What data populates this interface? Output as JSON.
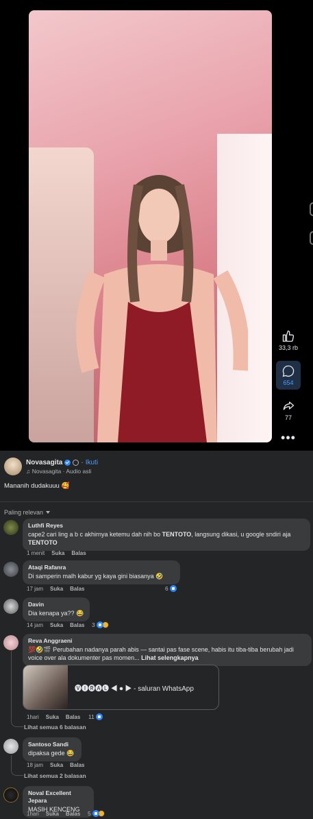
{
  "video": {
    "likes": "33,3 rb",
    "comments_count": "654",
    "shares": "77"
  },
  "post": {
    "author": "Novasagita",
    "follow_label": "Ikuti",
    "audio": "Novasagita · Audio asli",
    "caption": "Mananih dudakuuu 🥰"
  },
  "sort_label": "Paling relevan",
  "comments": [
    {
      "name": "Luthfi Reyes",
      "text_html": "cape2 cari ling a b c akhirnya ketemu dah nih bo <b>TENTOTO</b>, langsung dikasi, u google sndiri aja <b>TENTOTO</b>",
      "time": "1 menit",
      "like": "Suka",
      "reply": "Balas"
    },
    {
      "name": "Ataqi Rafanra",
      "text": "Di samperin malh kabur yg kaya gini biasanya 🤣",
      "time": "17 jam",
      "like": "Suka",
      "reply": "Balas",
      "reactions": "6"
    },
    {
      "name": "Davin",
      "text": "Dia kenapa ya?? 😂",
      "time": "14 jam",
      "like": "Suka",
      "reply": "Balas",
      "reactions": "3"
    },
    {
      "name": "Reva Anggraeni",
      "text": "💯🤣🎬 Perubahan nadanya parah abis — santai pas fase scene, habis itu tiba-tiba berubah jadi voice over ala dokumenter pas momen...",
      "see_more": "Lihat selengkapnya",
      "link_text": "🅥🅘🅡🅐🅛 ◀ ⏺ ▶ - saluran WhatsApp",
      "time": "1hari",
      "like": "Suka",
      "reply": "Balas",
      "reactions": "11",
      "view_replies": "Lihat semua 6 balasan"
    },
    {
      "name": "Santoso Sandi",
      "text": "dipaksa gede 😂",
      "time": "18 jam",
      "like": "Suka",
      "reply": "Balas",
      "view_replies": "Lihat semua 2 balasan"
    },
    {
      "name": "Noval Excellent Jepara",
      "text": "MASIH KENCENG",
      "time": "1hari",
      "like": "Suka",
      "reply": "Balas",
      "reactions": "5"
    }
  ]
}
